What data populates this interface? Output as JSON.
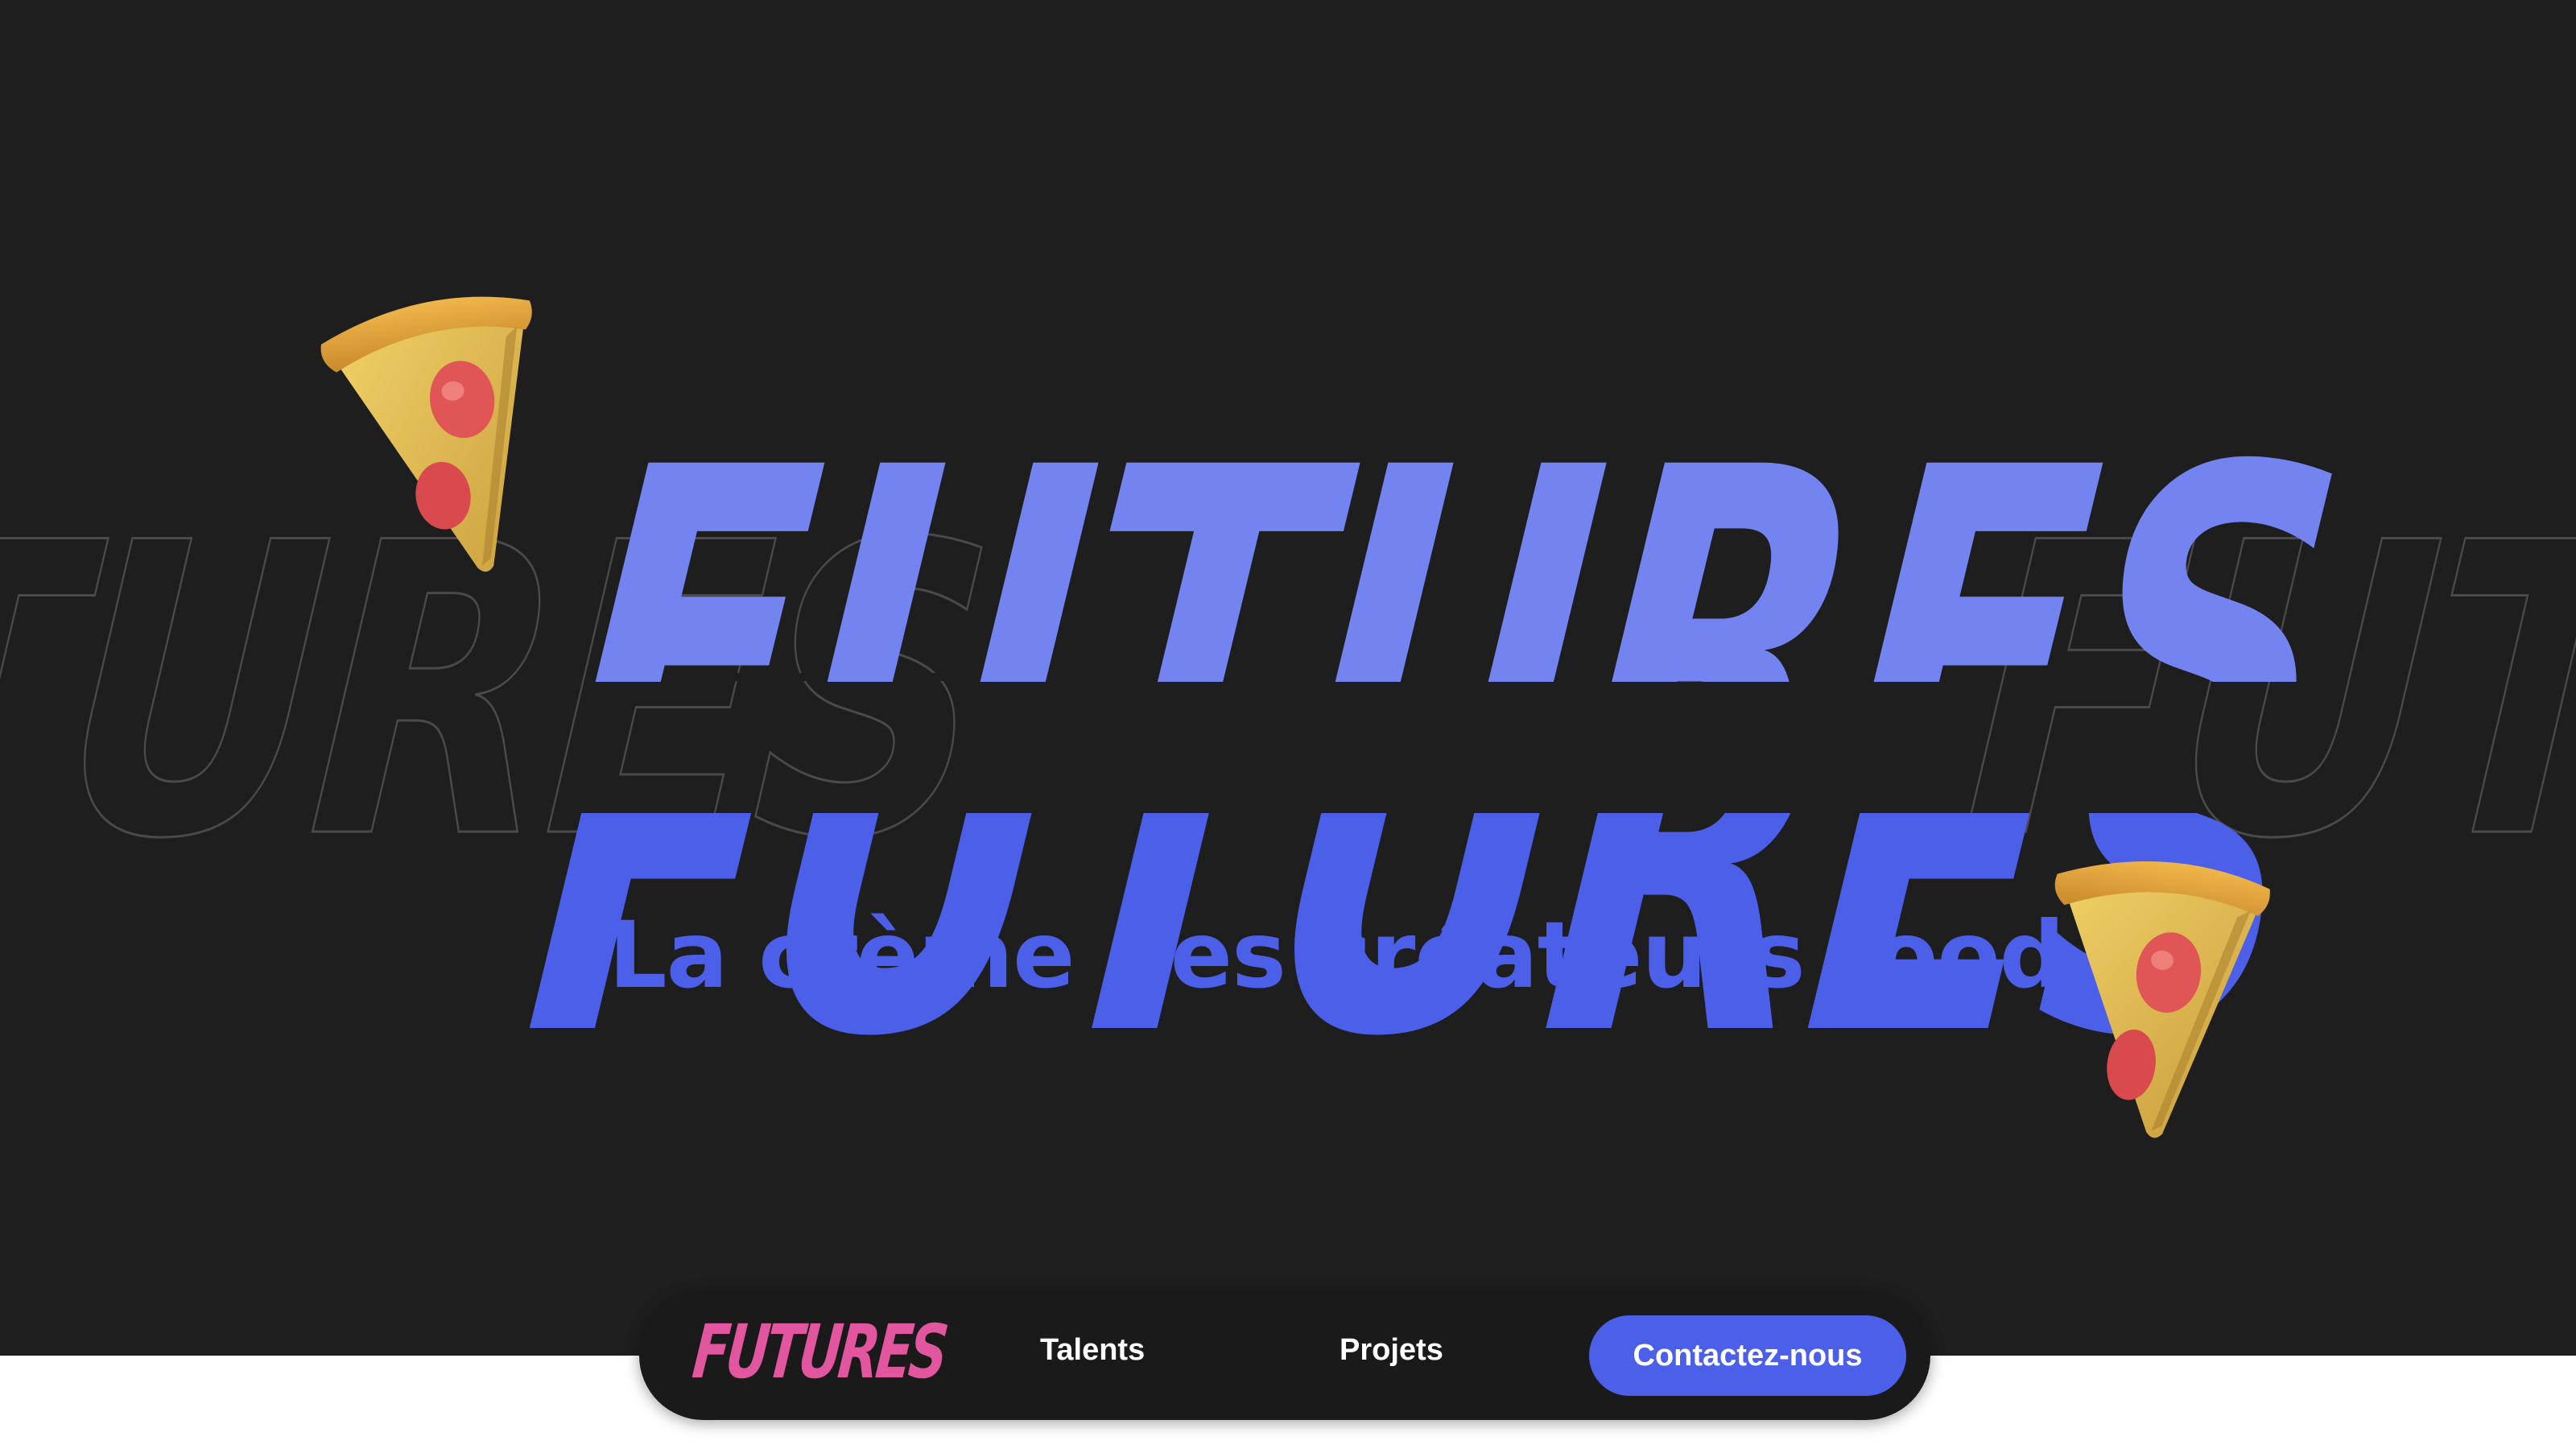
{
  "hero": {
    "brand_word": "FUTURES",
    "tagline": "La crème des créateurs food",
    "pizza_icons": [
      "pizza-slice-icon",
      "pizza-slice-icon"
    ]
  },
  "nav": {
    "logo": "FUTURES",
    "links": [
      {
        "label": "Talents"
      },
      {
        "label": "Projets"
      }
    ],
    "cta": "Contactez-nous"
  },
  "colors": {
    "background": "#1e1e1f",
    "brand_blue": "#4c5fe8",
    "brand_blue_light": "#7384f0",
    "logo_pink": "#e1569f",
    "outline_gray": "#4a4a4c"
  }
}
